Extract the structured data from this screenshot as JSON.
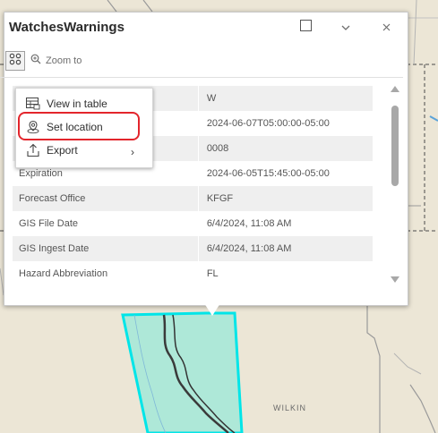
{
  "popup": {
    "title": "WatchesWarnings",
    "maximize_icon": "square-icon",
    "collapse_icon": "chevron-down-icon",
    "close_icon": "close-icon"
  },
  "toolbar": {
    "options_icon": "options-icon",
    "zoom_label": "Zoom to",
    "zoom_icon": "zoom-in-icon"
  },
  "menu": {
    "items": [
      {
        "label": "View in table",
        "icon": "table-icon"
      },
      {
        "label": "Set location",
        "icon": "location-icon"
      },
      {
        "label": "Export",
        "icon": "export-icon",
        "submenu": "›"
      }
    ]
  },
  "table": {
    "rows": [
      {
        "label": "",
        "value": "W"
      },
      {
        "label": "",
        "value": "2024-06-07T05:00:00-05:00"
      },
      {
        "label": "",
        "value": "0008"
      },
      {
        "label": "Expiration",
        "value": "2024-06-05T15:45:00-05:00"
      },
      {
        "label": "Forecast Office",
        "value": "KFGF"
      },
      {
        "label": "GIS File Date",
        "value": "6/4/2024, 11:08 AM"
      },
      {
        "label": "GIS Ingest Date",
        "value": "6/4/2024, 11:08 AM"
      },
      {
        "label": "Hazard Abbreviation",
        "value": "FL"
      }
    ]
  },
  "map": {
    "county_label": "WILKIN",
    "polygon_color": "#00e5e8",
    "polygon_fill": "#9ae8d8"
  }
}
